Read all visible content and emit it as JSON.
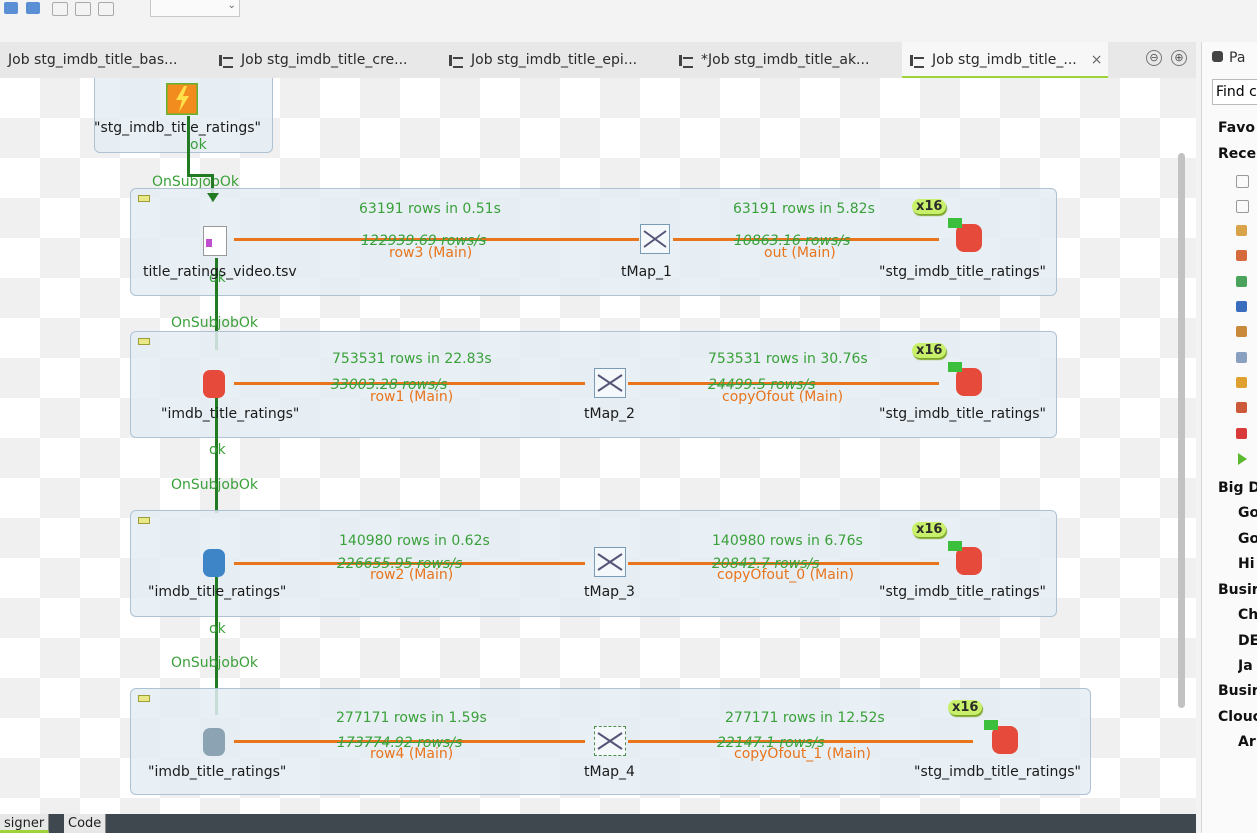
{
  "tabs": [
    {
      "label": "Job stg_imdb_title_bas..."
    },
    {
      "label": "Job stg_imdb_title_cre..."
    },
    {
      "label": "Job stg_imdb_title_epi..."
    },
    {
      "label": "*Job stg_imdb_title_ak..."
    },
    {
      "label": "Job stg_imdb_title_..."
    }
  ],
  "tab_close": "×",
  "tab_controls": {
    "minimize": "⊖",
    "maximize": "⊕"
  },
  "top_component": {
    "label": "\"stg_imdb_title_ratings\"",
    "ok": "ok"
  },
  "links": {
    "onsubjobok": "OnSubjobOk",
    "ok": "ok"
  },
  "subjobs": [
    {
      "input": "title_ratings_video.tsv",
      "in_stats": "63191 rows in 0.51s",
      "in_rate": "122939.69 rows/s",
      "in_flow": "row3 (Main)",
      "tmap": "tMap_1",
      "out_stats": "63191 rows in 5.82s",
      "out_rate": "10863.16 rows/s",
      "out_flow": "out (Main)",
      "output": "\"stg_imdb_title_ratings\"",
      "badge": "x16"
    },
    {
      "input": "\"imdb_title_ratings\"",
      "in_stats": "753531 rows in 22.83s",
      "in_rate": "33003.28 rows/s",
      "in_flow": "row1 (Main)",
      "tmap": "tMap_2",
      "out_stats": "753531 rows in 30.76s",
      "out_rate": "24499.5 rows/s",
      "out_flow": "copyOfout (Main)",
      "output": "\"stg_imdb_title_ratings\"",
      "badge": "x16"
    },
    {
      "input": "\"imdb_title_ratings\"",
      "in_stats": "140980 rows in 0.62s",
      "in_rate": "226655.95 rows/s",
      "in_flow": "row2 (Main)",
      "tmap": "tMap_3",
      "out_stats": "140980 rows in 6.76s",
      "out_rate": "20842.7 rows/s",
      "out_flow": "copyOfout_0 (Main)",
      "output": "\"stg_imdb_title_ratings\"",
      "badge": "x16"
    },
    {
      "input": "\"imdb_title_ratings\"",
      "in_stats": "277171 rows in 1.59s",
      "in_rate": "173774.92 rows/s",
      "in_flow": "row4 (Main)",
      "tmap": "tMap_4",
      "out_stats": "277171 rows in 12.52s",
      "out_rate": "22147.1 rows/s",
      "out_flow": "copyOfout_1 (Main)",
      "output": "\"stg_imdb_title_ratings\"",
      "badge": "x16"
    }
  ],
  "bottom_tabs": {
    "designer": "signer",
    "code": "Code"
  },
  "palette": {
    "title": "Pa",
    "find": "Find c",
    "favorites": "Favo",
    "recent": "Recer",
    "big_data": "Big D",
    "bd_items": [
      "Go",
      "Go",
      "Hi"
    ],
    "business": "Busir",
    "bus_items": [
      "Ch",
      "DE",
      "Ja"
    ],
    "business2": "Busir",
    "cloud": "Clouc",
    "cloud_items": [
      "Ar"
    ]
  },
  "colors": {
    "flow": "#e8741c",
    "link": "#227a22",
    "stats": "#3aa03a",
    "accent": "#9fd33a"
  }
}
